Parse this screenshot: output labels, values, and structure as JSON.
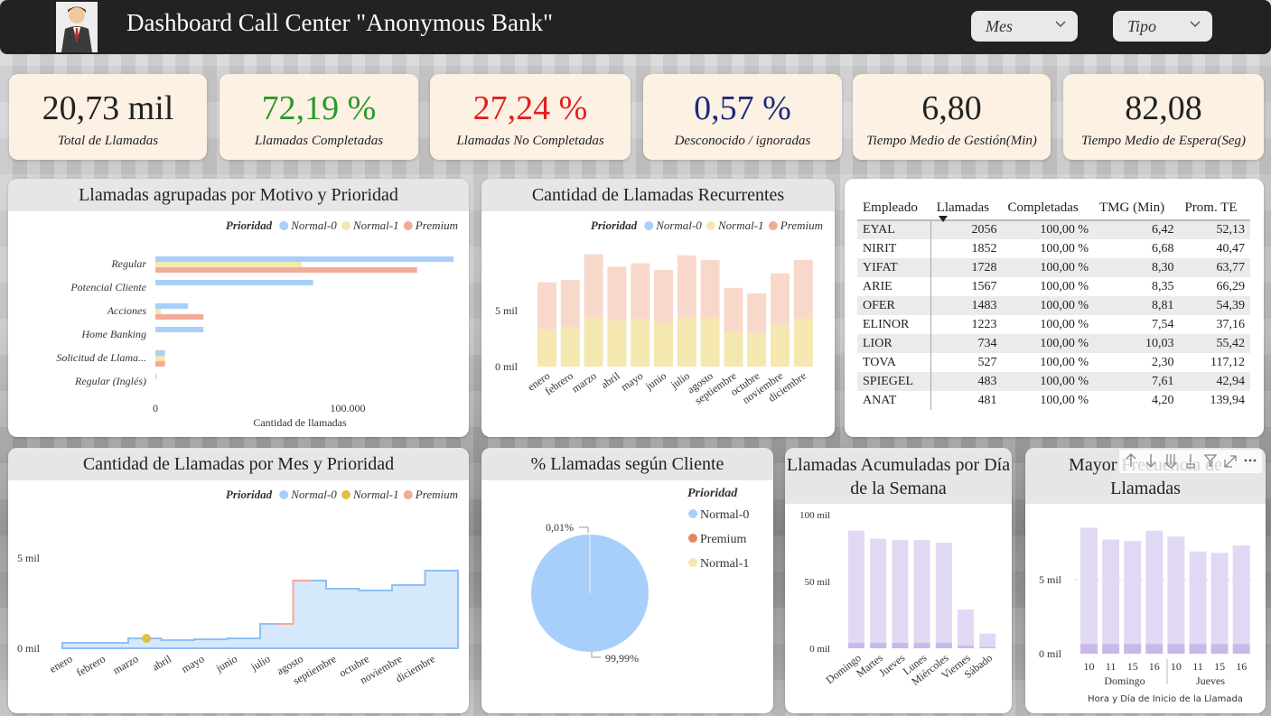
{
  "header": {
    "title": "Dashboard Call Center \"Anonymous Bank\"",
    "slicers": [
      {
        "label": "Mes"
      },
      {
        "label": "Tipo"
      }
    ]
  },
  "kpis": [
    {
      "value": "20,73 mil",
      "label": "Total de Llamadas",
      "color": "#111111"
    },
    {
      "value": "72,19 %",
      "label": "Llamadas Completadas",
      "color": "#2a9a2a"
    },
    {
      "value": "27,24 %",
      "label": "Llamadas No Completadas",
      "color": "#e02020"
    },
    {
      "value": "0,57 %",
      "label": "Desconocido / ignoradas",
      "color": "#1a2a7a"
    },
    {
      "value": "6,80",
      "label": "Tiempo Medio de Gestión(Min)",
      "color": "#111111"
    },
    {
      "value": "82,08",
      "label": "Tiempo Medio de Espera(Seg)",
      "color": "#111111"
    }
  ],
  "colors": {
    "normal0": "#a7cffa",
    "normal1": "#f4e7b0",
    "premium": "#f2ab98",
    "purple": "#e1d9f4",
    "purple_dark": "#c9b9ea"
  },
  "legend": {
    "title": "Prioridad",
    "normal0": "Normal-0",
    "normal1": "Normal-1",
    "premium": "Premium"
  },
  "chart_data": [
    {
      "id": "motivo",
      "type": "bar",
      "title": "Llamadas agrupadas por Motivo y Prioridad",
      "orientation": "horizontal",
      "categories": [
        "Regular",
        "Potencial Cliente",
        "Acciones",
        "Home Banking",
        "Solicitud de Llama...",
        "Regular (Inglés)"
      ],
      "series": [
        {
          "name": "Normal-0",
          "values": [
            155000,
            82000,
            17000,
            25000,
            5000,
            500
          ]
        },
        {
          "name": "Normal-1",
          "values": [
            76000,
            0,
            3000,
            0,
            5000,
            0
          ]
        },
        {
          "name": "Premium",
          "values": [
            136000,
            0,
            25000,
            0,
            5000,
            0
          ]
        }
      ],
      "xlabel": "Cantidad de llamadas",
      "xticks": [
        "0",
        "100.000"
      ],
      "xlim": [
        0,
        230000
      ]
    },
    {
      "id": "recurrentes",
      "type": "bar",
      "stacked": true,
      "title": "Cantidad de Llamadas Recurrentes",
      "categories": [
        "enero",
        "febrero",
        "marzo",
        "abril",
        "mayo",
        "junio",
        "julio",
        "agosto",
        "septiembre",
        "octubre",
        "noviembre",
        "diciembre"
      ],
      "series": [
        {
          "name": "Normal-1",
          "values": [
            3300,
            3500,
            4400,
            4100,
            4200,
            3900,
            4400,
            4300,
            3100,
            3000,
            3700,
            4300
          ]
        },
        {
          "name": "Premium",
          "values": [
            4200,
            4200,
            5600,
            4800,
            5000,
            4700,
            5500,
            5200,
            3900,
            3500,
            4600,
            5200
          ]
        }
      ],
      "yticks": [
        "0 mil",
        "5 mil"
      ],
      "ylim": [
        0,
        9000
      ]
    },
    {
      "id": "mes",
      "type": "area",
      "title": "Cantidad de Llamadas por Mes y Prioridad",
      "categories": [
        "enero",
        "febrero",
        "marzo",
        "abril",
        "mayo",
        "junio",
        "julio",
        "agosto",
        "septiembre",
        "octubre",
        "noviembre",
        "diciembre"
      ],
      "series": [
        {
          "name": "Normal-0",
          "values": [
            300,
            300,
            550,
            450,
            500,
            550,
            1350,
            3750,
            3300,
            3200,
            3500,
            4300
          ]
        },
        {
          "name": "Normal-1",
          "values": [
            0,
            0,
            550,
            0,
            0,
            0,
            0,
            0,
            0,
            0,
            0,
            0
          ]
        },
        {
          "name": "Premium",
          "values": [
            0,
            0,
            0,
            0,
            0,
            0,
            1350,
            3750,
            0,
            0,
            0,
            0
          ]
        }
      ],
      "yticks": [
        "0 mil",
        "5 mil"
      ],
      "ylim": [
        0,
        6000
      ]
    },
    {
      "id": "cliente",
      "type": "pie",
      "title": "% Llamadas según Cliente",
      "labels": [
        "Normal-0",
        "Premium",
        "Normal-1"
      ],
      "values": [
        99.99,
        0.01,
        0.0
      ],
      "data_labels": [
        "99,99%",
        "0,01%"
      ]
    },
    {
      "id": "semana",
      "type": "bar",
      "stacked": true,
      "title": "Llamadas Acumuladas por Día de la Semana",
      "categories": [
        "Domingo",
        "Martes",
        "Jueves",
        "Lunes",
        "Miércoles",
        "Viernes",
        "Sábado"
      ],
      "series": [
        {
          "name": "base",
          "values": [
            4,
            4,
            4,
            4,
            4,
            2,
            1
          ]
        },
        {
          "name": "total",
          "values": [
            88,
            82,
            81,
            81,
            79,
            29,
            11
          ]
        }
      ],
      "yticks": [
        "0 mil",
        "50 mil",
        "100 mil"
      ],
      "ylim": [
        0,
        105
      ]
    },
    {
      "id": "hora",
      "type": "bar",
      "stacked": true,
      "title": "Mayor Frecuencia de Llamadas",
      "categories": [
        "10",
        "11",
        "15",
        "16",
        "10",
        "11",
        "15",
        "16"
      ],
      "groups": [
        "Domingo",
        "Jueves"
      ],
      "series": [
        {
          "name": "base",
          "values": [
            400,
            400,
            400,
            400,
            400,
            400,
            400,
            400
          ]
        },
        {
          "name": "total",
          "values": [
            8500,
            7700,
            7600,
            8300,
            7900,
            6900,
            6800,
            7300
          ]
        }
      ],
      "yticks": [
        "0 mil",
        "5 mil"
      ],
      "ylim": [
        0,
        9500
      ],
      "xlabel": "Hora y Día de Inicio de la Llamada"
    }
  ],
  "employee_table": {
    "columns": [
      "Empleado",
      "Llamadas",
      "Completadas",
      "TMG (Min)",
      "Prom. TE"
    ],
    "rows": [
      [
        "EYAL",
        "2056",
        "100,00 %",
        "6,42",
        "52,13"
      ],
      [
        "NIRIT",
        "1852",
        "100,00 %",
        "6,68",
        "40,47"
      ],
      [
        "YIFAT",
        "1728",
        "100,00 %",
        "8,30",
        "63,77"
      ],
      [
        "ARIE",
        "1567",
        "100,00 %",
        "8,35",
        "66,29"
      ],
      [
        "OFER",
        "1483",
        "100,00 %",
        "8,81",
        "54,39"
      ],
      [
        "ELINOR",
        "1223",
        "100,00 %",
        "7,54",
        "37,16"
      ],
      [
        "LIOR",
        "734",
        "100,00 %",
        "10,03",
        "55,42"
      ],
      [
        "TOVA",
        "527",
        "100,00 %",
        "2,30",
        "117,12"
      ],
      [
        "SPIEGEL",
        "483",
        "100,00 %",
        "7,61",
        "42,94"
      ],
      [
        "ANAT",
        "481",
        "100,00 %",
        "4,20",
        "139,94"
      ]
    ]
  },
  "icons": [
    "businessman-avatar-icon",
    "chevron-down-icon",
    "sort-down-icon",
    "drill-up-icon",
    "drill-down-icon",
    "expand-all-icon",
    "filter-icon",
    "focus-mode-icon",
    "more-options-icon"
  ]
}
